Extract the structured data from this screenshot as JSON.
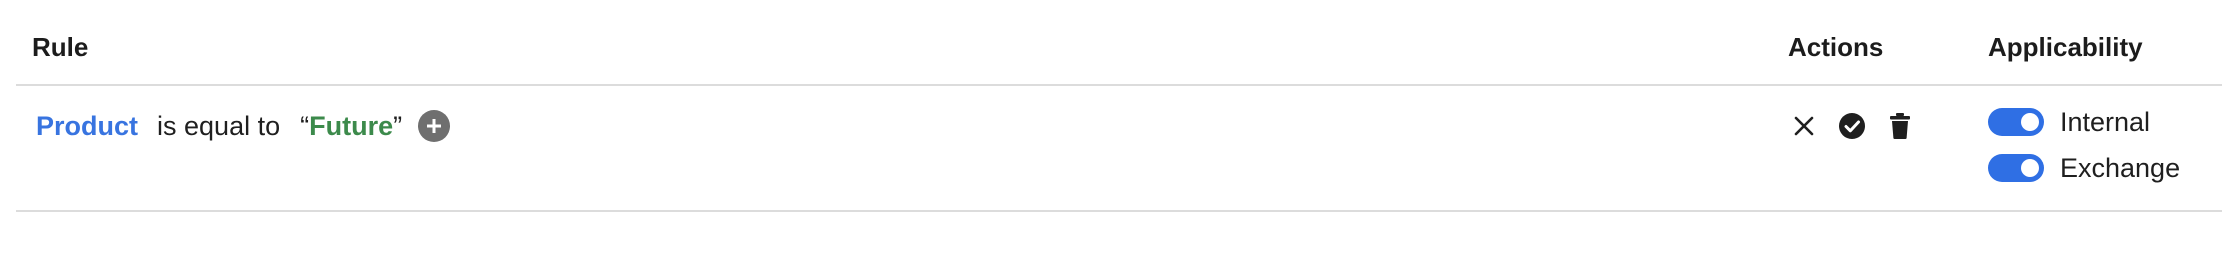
{
  "table": {
    "headers": {
      "rule": "Rule",
      "actions": "Actions",
      "applicability": "Applicability"
    },
    "row": {
      "field": "Product",
      "operator": "is equal to",
      "open_quote": "“",
      "value": "Future",
      "close_quote": "”",
      "add_icon": "plus-circle-icon",
      "actions": {
        "cancel_icon": "close-icon",
        "confirm_icon": "check-circle-icon",
        "delete_icon": "trash-icon"
      },
      "applicability": [
        {
          "label": "Internal",
          "enabled": true
        },
        {
          "label": "Exchange",
          "enabled": true
        }
      ]
    }
  },
  "colors": {
    "field_link": "#3874e0",
    "value_text": "#3c8a4b",
    "toggle_on": "#2f6fe4",
    "add_button": "#6f6f6f",
    "divider": "#dcdcdc"
  }
}
